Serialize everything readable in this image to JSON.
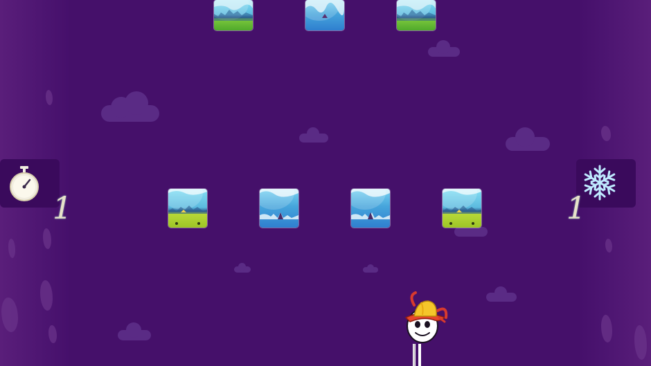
{
  "hud": {
    "timer_powerup": {
      "icon": "stopwatch-icon",
      "count": "1"
    },
    "freeze_powerup": {
      "icon": "snowflake-icon",
      "count": "1"
    }
  },
  "tiles": {
    "top_row": [
      "green",
      "blue",
      "green"
    ],
    "middle_row": [
      "lime",
      "blue",
      "blue",
      "lime"
    ]
  },
  "player": {
    "character": "egg-head-character-with-hat"
  },
  "colors": {
    "background": "#45106a",
    "side_panel": "#3a0a5c",
    "counter_text": "#e7e2c9",
    "snowflake": "#bfeaff"
  }
}
